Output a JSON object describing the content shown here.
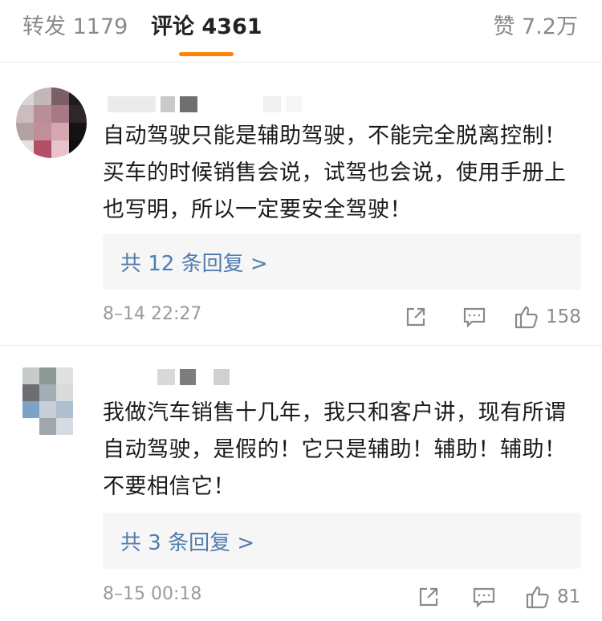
{
  "tabs": {
    "reposts": "转发 1179",
    "comments": "评论 4361",
    "likes": "赞 7.2万"
  },
  "comments": [
    {
      "text": "自动驾驶只能是辅助驾驶，不能完全脱离控制！买车的时候销售会说，试驾也会说，使用手册上也写明，所以一定要安全驾驶！",
      "replies": "共 12 条回复 >",
      "time": "8–14 22:27",
      "likes": "158"
    },
    {
      "text": "我做汽车销售十几年，我只和客户讲，现有所谓自动驾驶，是假的！它只是辅助！辅助！辅助！不要相信它！",
      "replies": "共 3 条回复 >",
      "time": "8–15 00:18",
      "likes": "81"
    }
  ],
  "colors": {
    "accent": "#ff8200",
    "link": "#507daf",
    "muted": "#9a9a9a"
  },
  "icons": [
    "share-icon",
    "reply-icon",
    "thumbs-up-icon"
  ]
}
